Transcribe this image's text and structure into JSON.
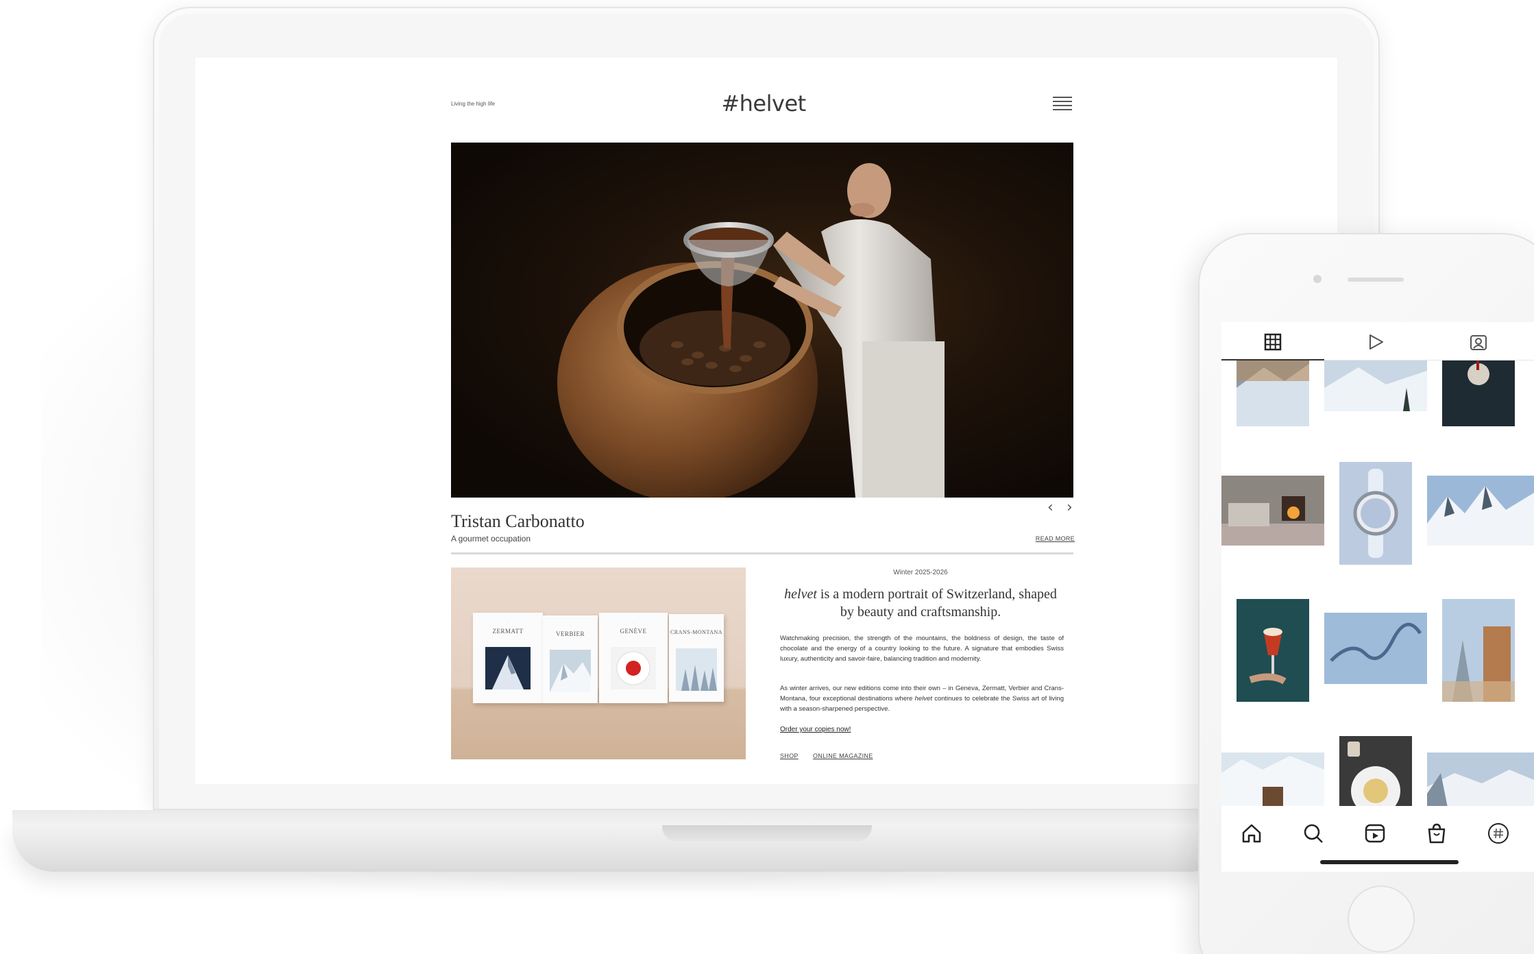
{
  "site": {
    "tagline": "Living the high life",
    "logo": "#helvet",
    "hero": {
      "title": "Tristan Carbonatto",
      "subtitle": "A gourmet occupation",
      "read_more": "READ MORE",
      "prev": "‹",
      "next": "›"
    },
    "edition": {
      "label": "Winter 2025-2026",
      "headline_brand": "helvet",
      "headline_rest": " is a modern portrait of Switzerland, shaped by beauty and craftsmanship.",
      "paragraph1": "Watchmaking precision, the strength of the mountains, the boldness of design, the taste of chocolate and the energy of a country looking to the future. A signature that embodies Swiss luxury, authenticity and savoir-faire, balancing tradition and modernity.",
      "paragraph2_before": "As winter arrives, our new editions come into their own – in Geneva, Zermatt, Verbier and Crans-Montana, four exceptional destinations where ",
      "paragraph2_brand": "helvet",
      "paragraph2_after": " continues to celebrate the Swiss art of living with a season-sharpened perspective.",
      "order_link": "Order your copies now!",
      "shop_link": "SHOP",
      "online_link": "ONLINE MAGAZINE"
    },
    "magazines": [
      {
        "title": "ZERMATT"
      },
      {
        "title": "VERBIER"
      },
      {
        "title": "GENÈVE"
      },
      {
        "title": "CRANS-MONTANA"
      }
    ]
  },
  "phone": {
    "tabs": [
      "grid-icon",
      "reels-icon",
      "tagged-icon"
    ],
    "bottom_nav": [
      "home-icon",
      "search-icon",
      "reels-icon",
      "shop-icon",
      "profile-icon"
    ]
  },
  "colors": {
    "hero_bg": "#1f130a",
    "magazine_bg": "#e3cfc0",
    "text": "#333333"
  }
}
